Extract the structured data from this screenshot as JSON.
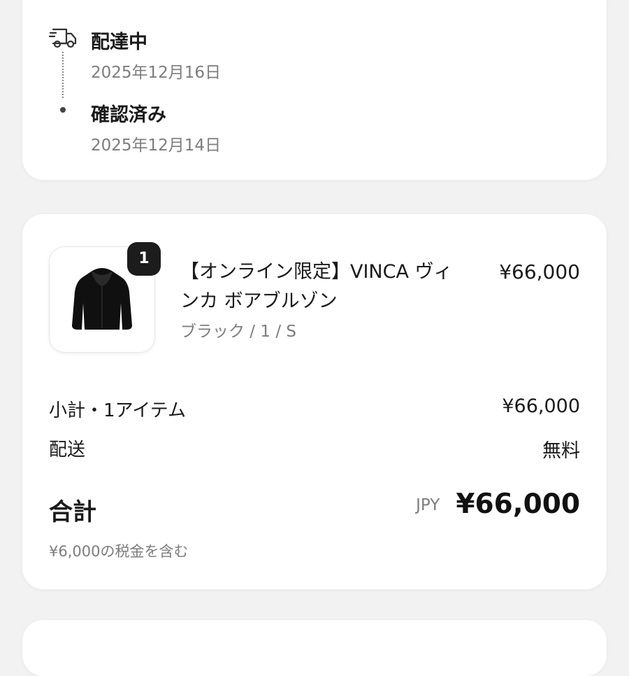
{
  "timeline": {
    "icon": "delivery-truck-icon",
    "steps": [
      {
        "status": "配達中",
        "date": "2025年12月16日"
      },
      {
        "status": "確認済み",
        "date": "2025年12月14日"
      }
    ]
  },
  "order": {
    "item": {
      "image": "black-fur-jacket-image",
      "quantity": "1",
      "name": "【オンライン限定】VINCA ヴィンカ ボアブルゾン",
      "variant": "ブラック / 1 / S",
      "price": "¥66,000"
    },
    "summary": {
      "subtotal_label": "小計・1アイテム",
      "subtotal_value": "¥66,000",
      "shipping_label": "配送",
      "shipping_value": "無料",
      "total_label": "合計",
      "total_currency": "JPY",
      "total_value": "¥66,000",
      "tax_note": "¥6,000の税金を含む"
    }
  },
  "colors": {
    "background": "#f2f2f2",
    "card": "#ffffff",
    "text": "#1a1a1a",
    "muted": "#7d7d7d",
    "badge": "#1c1c1c"
  }
}
